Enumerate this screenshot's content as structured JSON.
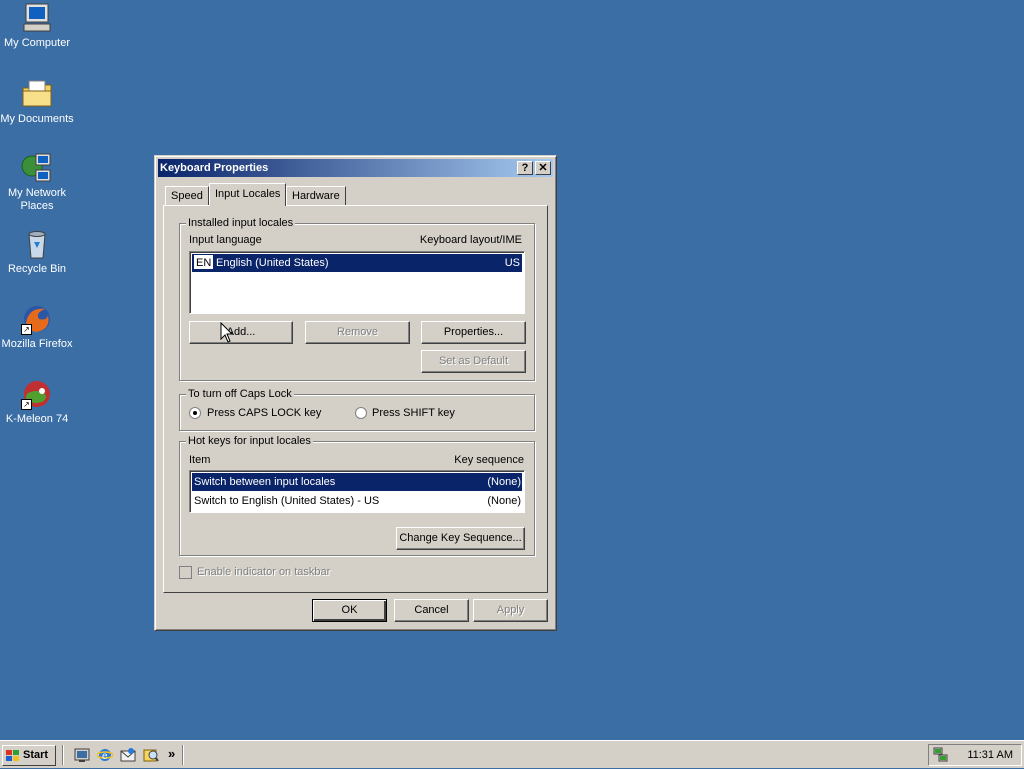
{
  "desktop": {
    "icons": [
      {
        "label": "My Computer"
      },
      {
        "label": "My Documents"
      },
      {
        "label": "My Network Places"
      },
      {
        "label": "Recycle Bin"
      },
      {
        "label": "Mozilla Firefox"
      },
      {
        "label": "K-Meleon 74"
      }
    ]
  },
  "dialog": {
    "title": "Keyboard Properties",
    "help_glyph": "?",
    "close_glyph": "✕",
    "tabs": [
      {
        "label": "Speed",
        "active": false
      },
      {
        "label": "Input Locales",
        "active": true
      },
      {
        "label": "Hardware",
        "active": false
      }
    ],
    "installed": {
      "group_title": "Installed input locales",
      "col_language": "Input language",
      "col_layout": "Keyboard layout/IME",
      "rows": [
        {
          "badge": "EN",
          "language": "English (United States)",
          "layout": "US",
          "selected": true
        }
      ],
      "add_label": "Add...",
      "remove_label": "Remove",
      "properties_label": "Properties...",
      "set_default_label": "Set as Default"
    },
    "capslock": {
      "group_title": "To turn off Caps Lock",
      "option_caps": "Press CAPS LOCK key",
      "option_shift": "Press SHIFT key",
      "selected": "caps"
    },
    "hotkeys": {
      "group_title": "Hot keys for input locales",
      "col_item": "Item",
      "col_seq": "Key sequence",
      "rows": [
        {
          "item": "Switch between input locales",
          "seq": "(None)",
          "selected": true
        },
        {
          "item": "Switch to English (United States) - US",
          "seq": "(None)",
          "selected": false
        }
      ],
      "change_label": "Change Key Sequence..."
    },
    "indicator_label": "Enable indicator on taskbar",
    "ok_label": "OK",
    "cancel_label": "Cancel",
    "apply_label": "Apply"
  },
  "taskbar": {
    "start_label": "Start",
    "more_glyph": "»",
    "clock": "11:31 AM"
  },
  "colors": {
    "desktop": "#3a6ea5",
    "selection": "#0a246a",
    "face": "#d4d0c8"
  }
}
